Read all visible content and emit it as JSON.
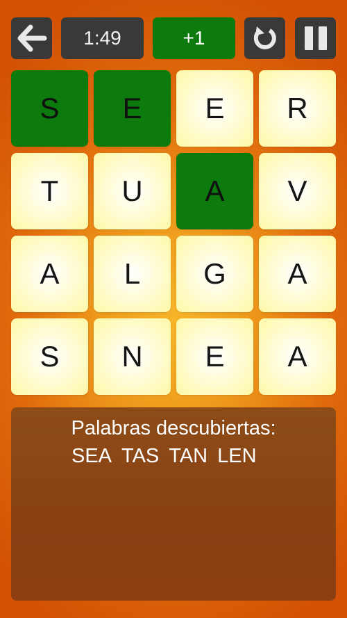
{
  "toolbar": {
    "back_icon": "arrow-left-icon",
    "timer": "1:49",
    "score_bonus": "+1",
    "restart_icon": "restart-icon",
    "pause_icon": "pause-icon"
  },
  "colors": {
    "background_center": "#f6b52a",
    "background_edge": "#d35205",
    "button_dark": "#3a3937",
    "accent_green": "#0c7a0c",
    "tile_light": "#fdf8a6",
    "panel_brown": "#8a4114"
  },
  "grid": {
    "rows": [
      [
        {
          "letter": "S",
          "selected": true
        },
        {
          "letter": "E",
          "selected": true
        },
        {
          "letter": "E",
          "selected": false
        },
        {
          "letter": "R",
          "selected": false
        }
      ],
      [
        {
          "letter": "T",
          "selected": false
        },
        {
          "letter": "U",
          "selected": false
        },
        {
          "letter": "A",
          "selected": true
        },
        {
          "letter": "V",
          "selected": false
        }
      ],
      [
        {
          "letter": "A",
          "selected": false
        },
        {
          "letter": "L",
          "selected": false
        },
        {
          "letter": "G",
          "selected": false
        },
        {
          "letter": "A",
          "selected": false
        }
      ],
      [
        {
          "letter": "S",
          "selected": false
        },
        {
          "letter": "N",
          "selected": false
        },
        {
          "letter": "E",
          "selected": false
        },
        {
          "letter": "A",
          "selected": false
        }
      ]
    ]
  },
  "panel": {
    "title": "Palabras descubiertas:",
    "words": [
      "SEA",
      "TAS",
      "TAN",
      "LEN"
    ]
  }
}
